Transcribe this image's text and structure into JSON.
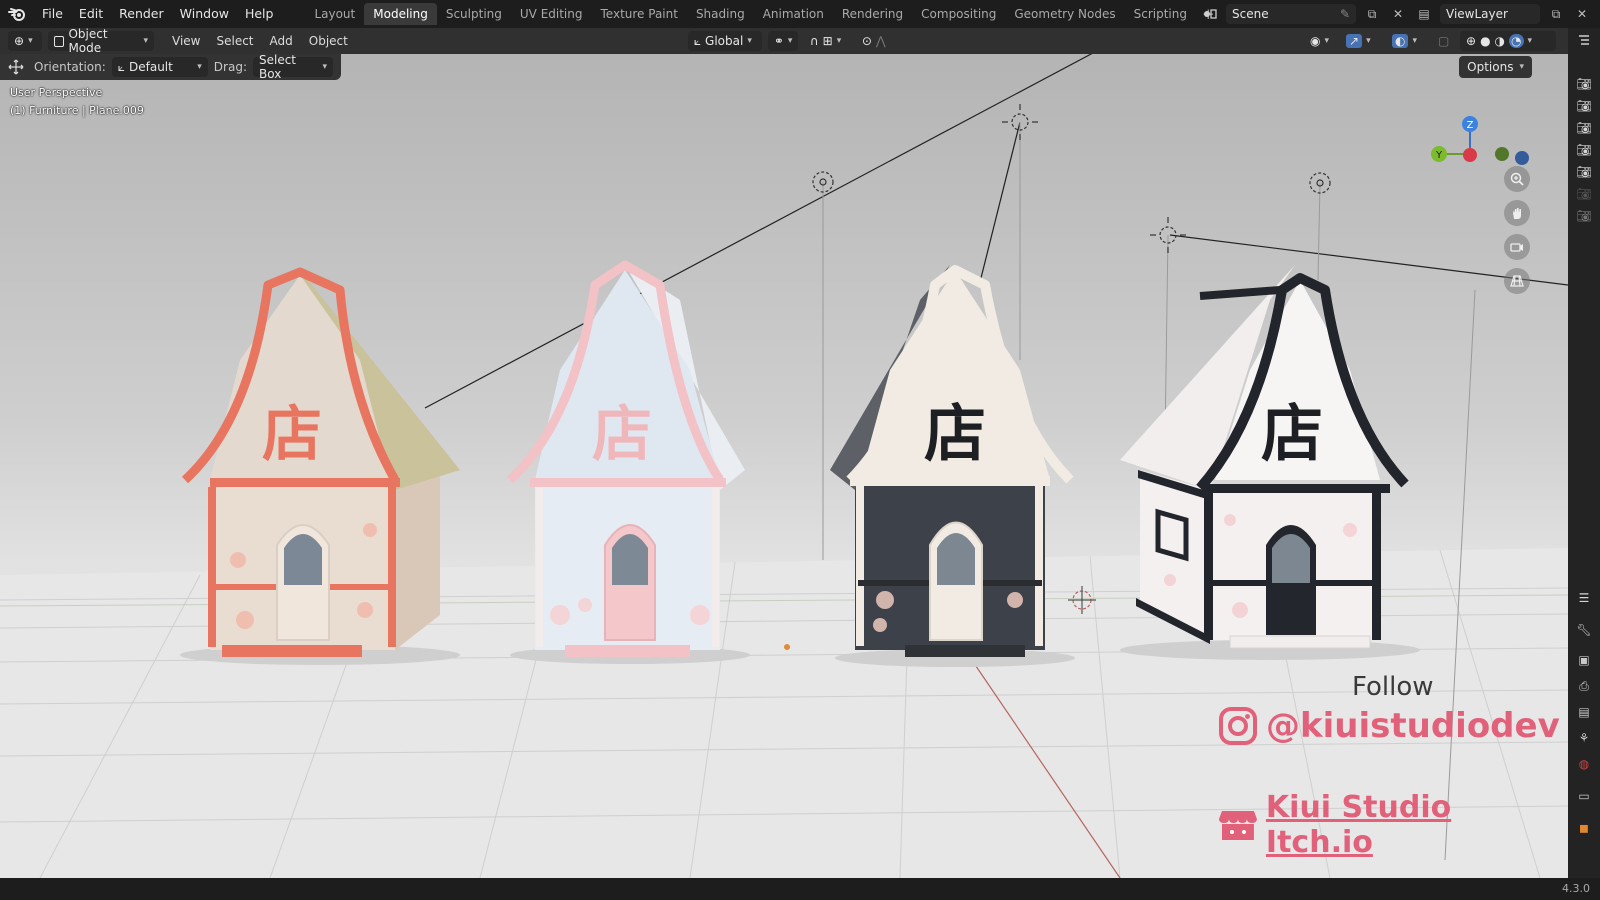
{
  "menu": [
    "File",
    "Edit",
    "Render",
    "Window",
    "Help"
  ],
  "workspaces": {
    "tabs": [
      "Layout",
      "Modeling",
      "Sculpting",
      "UV Editing",
      "Texture Paint",
      "Shading",
      "Animation",
      "Rendering",
      "Compositing",
      "Geometry Nodes",
      "Scripting"
    ],
    "active": "Modeling"
  },
  "scene": {
    "name": "Scene"
  },
  "view_layer": {
    "name": "ViewLayer"
  },
  "viewport_header": {
    "mode": "Object Mode",
    "menus": [
      "View",
      "Select",
      "Add",
      "Object"
    ],
    "transform_orientation": "Global"
  },
  "tool_settings": {
    "orientation_label": "Orientation:",
    "orientation_value": "Default",
    "drag_label": "Drag:",
    "drag_value": "Select Box"
  },
  "options_label": "Options",
  "viewport_info": {
    "perspective": "User Perspective",
    "context": "(1) Furniture | Plane.009"
  },
  "gizmo_axes": {
    "z": "Z",
    "y": "Y"
  },
  "houses": [
    {
      "sign": "店",
      "trim_color": "#e8755f",
      "roof_color": "#c9c29a",
      "wall_color": "#e9dcd0"
    },
    {
      "sign": "店",
      "trim_color": "#f2c2c6",
      "roof_color": "#eaeef2",
      "wall_color": "#e6ecf3"
    },
    {
      "sign": "店",
      "trim_color": "#f1ebe3",
      "roof_color": "#5d6066",
      "wall_color": "#3d4149"
    },
    {
      "sign": "店",
      "trim_color": "#22252b",
      "roof_color": "#f3eeee",
      "wall_color": "#f4f0f0"
    }
  ],
  "promo": {
    "follow": "Follow",
    "instagram": "@kiuistudiodev",
    "itch": "Kiui Studio Itch.io"
  },
  "status": {
    "version": "4.3.0"
  }
}
